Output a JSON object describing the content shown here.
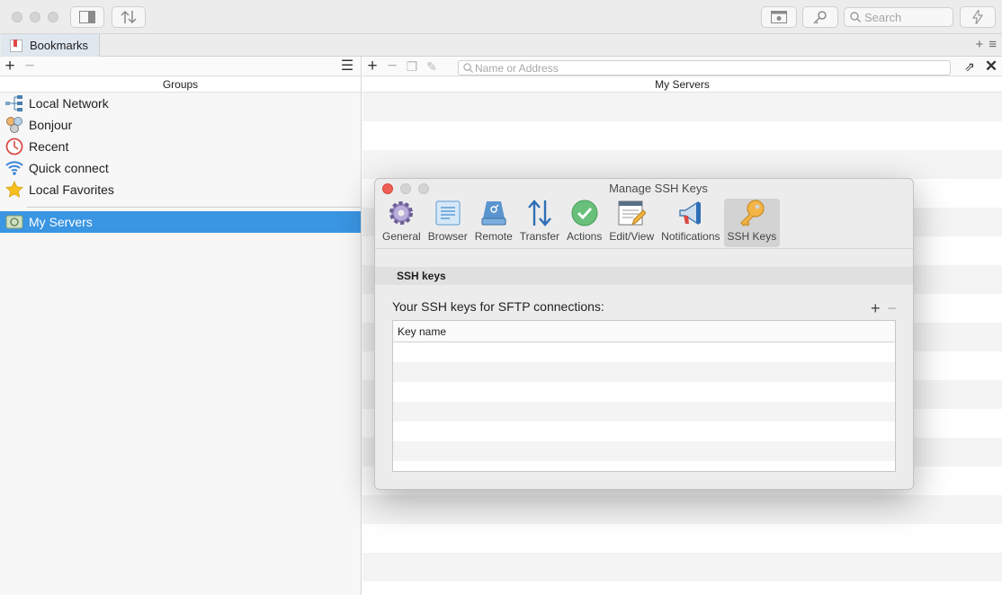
{
  "toolbar": {
    "search_placeholder": "Search"
  },
  "tab": {
    "label": "Bookmarks"
  },
  "groups": {
    "header": "Groups",
    "items": [
      {
        "label": "Local Network",
        "icon": "network-icon"
      },
      {
        "label": "Bonjour",
        "icon": "bonjour-icon"
      },
      {
        "label": "Recent",
        "icon": "clock-icon"
      },
      {
        "label": "Quick connect",
        "icon": "wifi-icon"
      },
      {
        "label": "Local Favorites",
        "icon": "star-icon"
      }
    ],
    "selected": {
      "label": "My Servers",
      "icon": "server-folder-icon"
    }
  },
  "servers": {
    "header": "My Servers",
    "address_placeholder": "Name or Address"
  },
  "dialog": {
    "title": "Manage SSH Keys",
    "tabs": [
      "General",
      "Browser",
      "Remote",
      "Transfer",
      "Actions",
      "Edit/View",
      "Notifications",
      "SSH Keys"
    ],
    "active_tab": "SSH Keys",
    "section_title": "SSH keys",
    "keys_label": "Your SSH keys for SFTP connections:",
    "table_header": "Key name"
  },
  "colors": {
    "selection": "#3a95e2",
    "close_red": "#ed5f55"
  }
}
